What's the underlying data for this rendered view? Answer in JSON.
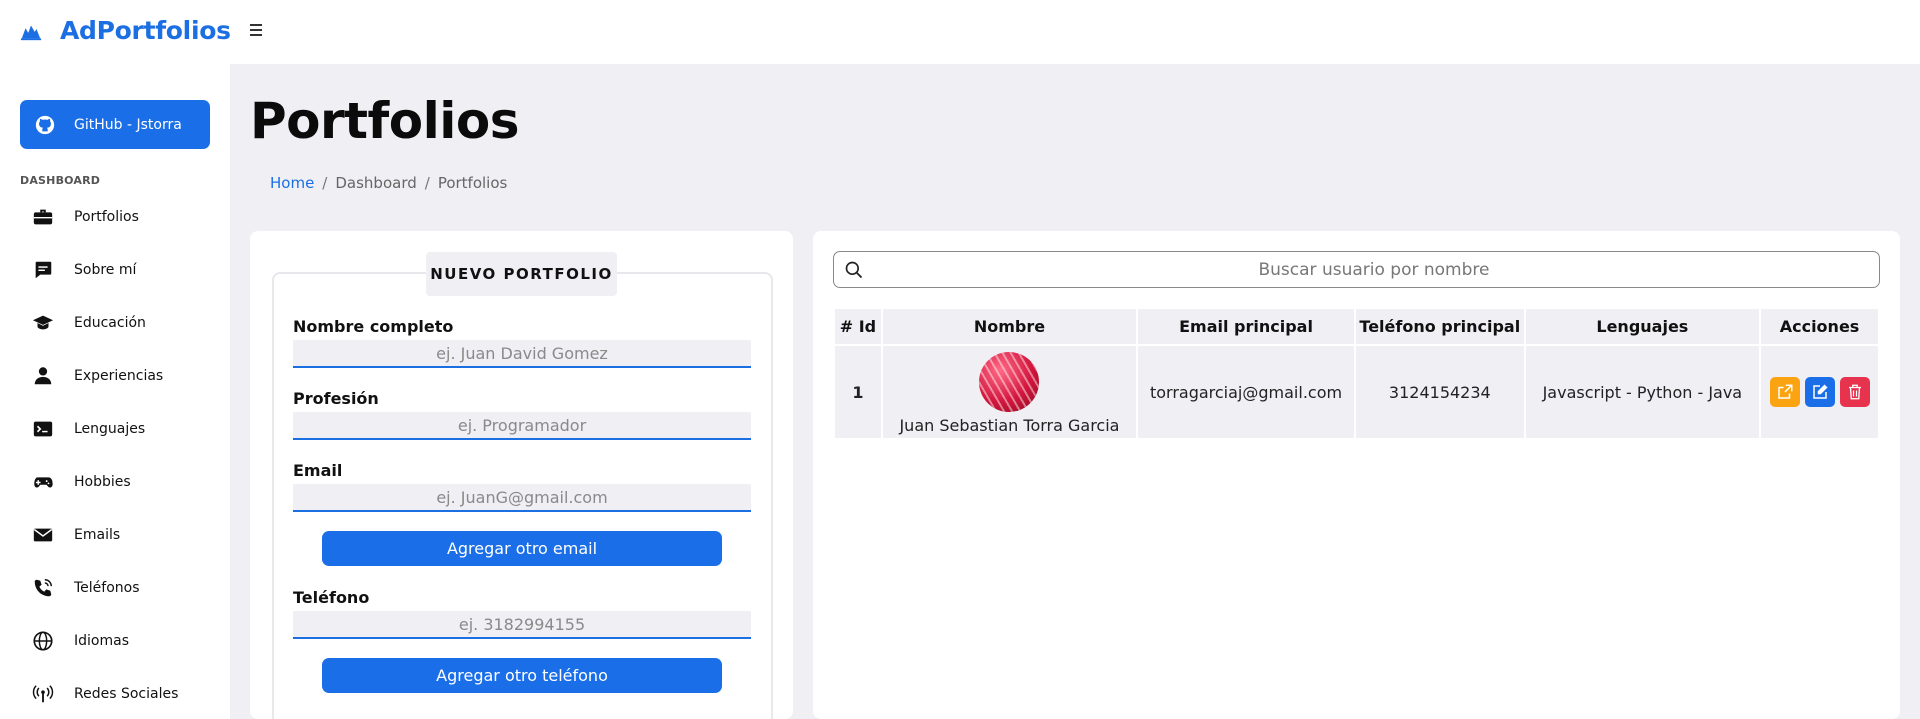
{
  "brand": {
    "name": "AdPortfolios",
    "icon": "mountain-chart-icon"
  },
  "sidebar": {
    "github_label": "GitHub - Jstorra",
    "heading": "DASHBOARD",
    "items": [
      {
        "label": "Portfolios",
        "icon": "briefcase-icon"
      },
      {
        "label": "Sobre mí",
        "icon": "message-icon"
      },
      {
        "label": "Educación",
        "icon": "graduation-cap-icon"
      },
      {
        "label": "Experiencias",
        "icon": "users-icon"
      },
      {
        "label": "Lenguajes",
        "icon": "terminal-icon"
      },
      {
        "label": "Hobbies",
        "icon": "gamepad-icon"
      },
      {
        "label": "Emails",
        "icon": "envelope-icon"
      },
      {
        "label": "Teléfonos",
        "icon": "phone-icon"
      },
      {
        "label": "Idiomas",
        "icon": "globe-icon"
      },
      {
        "label": "Redes Sociales",
        "icon": "broadcast-icon"
      }
    ]
  },
  "page": {
    "title": "Portfolios",
    "breadcrumb": [
      "Home",
      "Dashboard",
      "Portfolios"
    ]
  },
  "form": {
    "legend": "NUEVO PORTFOLIO",
    "name_label": "Nombre completo",
    "name_placeholder": "ej. Juan David Gomez",
    "profession_label": "Profesión",
    "profession_placeholder": "ej. Programador",
    "email_label": "Email",
    "email_placeholder": "ej. JuanG@gmail.com",
    "add_email_label": "Agregar otro email",
    "phone_label": "Teléfono",
    "phone_placeholder": "ej. 3182994155",
    "add_phone_label": "Agregar otro teléfono"
  },
  "table": {
    "search_placeholder": "Buscar usuario por nombre",
    "headers": [
      "# Id",
      "Nombre",
      "Email principal",
      "Teléfono principal",
      "Lenguajes",
      "Acciones"
    ],
    "rows": [
      {
        "id": "1",
        "name": "Juan Sebastian Torra Garcia",
        "email": "torragarciaj@gmail.com",
        "phone": "3124154234",
        "languages": "Javascript - Python - Java"
      }
    ],
    "action_colors": {
      "open": "#fca311",
      "edit": "#1a6fe8",
      "delete": "#e8334f"
    }
  }
}
